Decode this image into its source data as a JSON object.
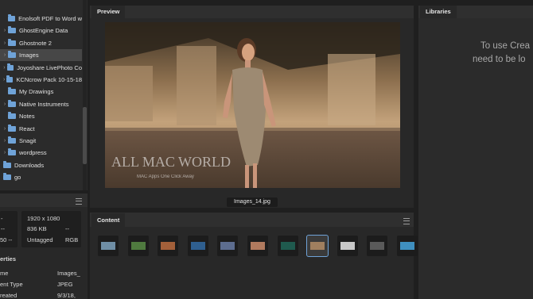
{
  "tree": {
    "items": [
      {
        "label": "Enolsoft PDF to Word w",
        "chevron": "",
        "selected": false
      },
      {
        "label": "GhostEngine Data",
        "chevron": ">",
        "selected": false
      },
      {
        "label": "Ghostnote 2",
        "chevron": ">",
        "selected": false
      },
      {
        "label": "Images",
        "chevron": ">",
        "selected": true
      },
      {
        "label": "Joyoshare LivePhoto Co",
        "chevron": ">",
        "selected": false
      },
      {
        "label": "KCNcrow Pack 10-15-18",
        "chevron": ">",
        "selected": false
      },
      {
        "label": "My Drawings",
        "chevron": "",
        "selected": false
      },
      {
        "label": "Native Instruments",
        "chevron": ">",
        "selected": false
      },
      {
        "label": "Notes",
        "chevron": "",
        "selected": false
      },
      {
        "label": "React",
        "chevron": ">",
        "selected": false
      },
      {
        "label": "Snagit",
        "chevron": ">",
        "selected": false
      },
      {
        "label": "wordpress",
        "chevron": ">",
        "selected": false
      },
      {
        "label": "Downloads",
        "chevron": "",
        "selected": false
      },
      {
        "label": "go",
        "chevron": "",
        "selected": false
      }
    ]
  },
  "info": {
    "dim_left": "-",
    "size_left": "--",
    "tag_left": "50 --",
    "dimensions": "1920 x 1080",
    "filesize": "836 KB",
    "filesize_extra": "--",
    "label": "Untagged",
    "colormode": "RGB",
    "properties_title": "erties",
    "props": [
      {
        "key": "me",
        "value": "Images_"
      },
      {
        "key": "ent Type",
        "value": "JPEG"
      },
      {
        "key": "reated",
        "value": "9/3/18,"
      }
    ]
  },
  "preview": {
    "tab": "Preview",
    "filename": "Images_14.jpg",
    "watermark_title": "ALL MAC WORLD",
    "watermark_sub": "MAC Apps One Click Away"
  },
  "content": {
    "tab": "Content",
    "thumbs": [
      "lake",
      "forest",
      "sunset",
      "ocean",
      "city",
      "coast",
      "lamp",
      "selected-portrait",
      "snow",
      "car",
      "pool"
    ]
  },
  "libraries": {
    "tab": "Libraries",
    "message_line1": "To use Crea",
    "message_line2": "need to be lo"
  }
}
